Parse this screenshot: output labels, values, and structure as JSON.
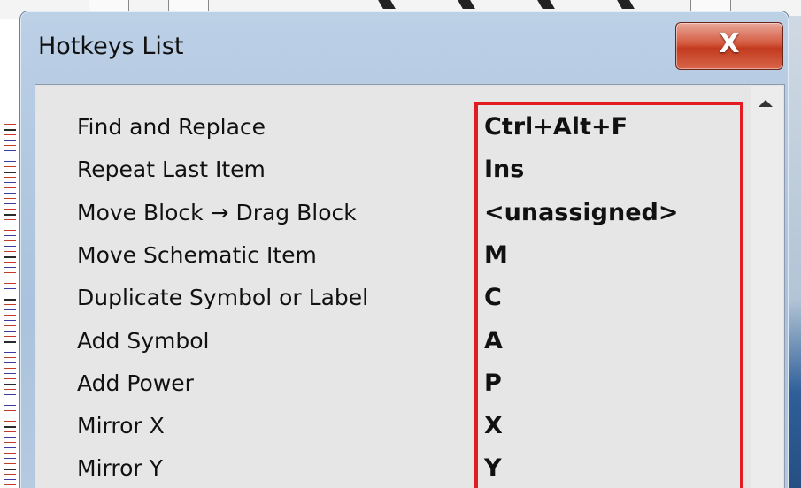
{
  "window": {
    "title": "Hotkeys List",
    "close_label": "X"
  },
  "hotkeys": [
    {
      "command": "Find and Replace",
      "key": "Ctrl+Alt+F"
    },
    {
      "command": "Repeat Last Item",
      "key": "Ins"
    },
    {
      "command": "Move Block → Drag Block",
      "key": "<unassigned>"
    },
    {
      "command": "Move Schematic Item",
      "key": "M"
    },
    {
      "command": "Duplicate Symbol or Label",
      "key": "C"
    },
    {
      "command": "Add Symbol",
      "key": "A"
    },
    {
      "command": "Add Power",
      "key": "P"
    },
    {
      "command": "Mirror X",
      "key": "X"
    },
    {
      "command": "Mirror Y",
      "key": "Y"
    }
  ],
  "colors": {
    "highlight": "#e31b23",
    "close_button": "#c23a1e"
  },
  "icons": {
    "close": "close-icon",
    "scroll_up": "scroll-up-arrow-icon"
  }
}
